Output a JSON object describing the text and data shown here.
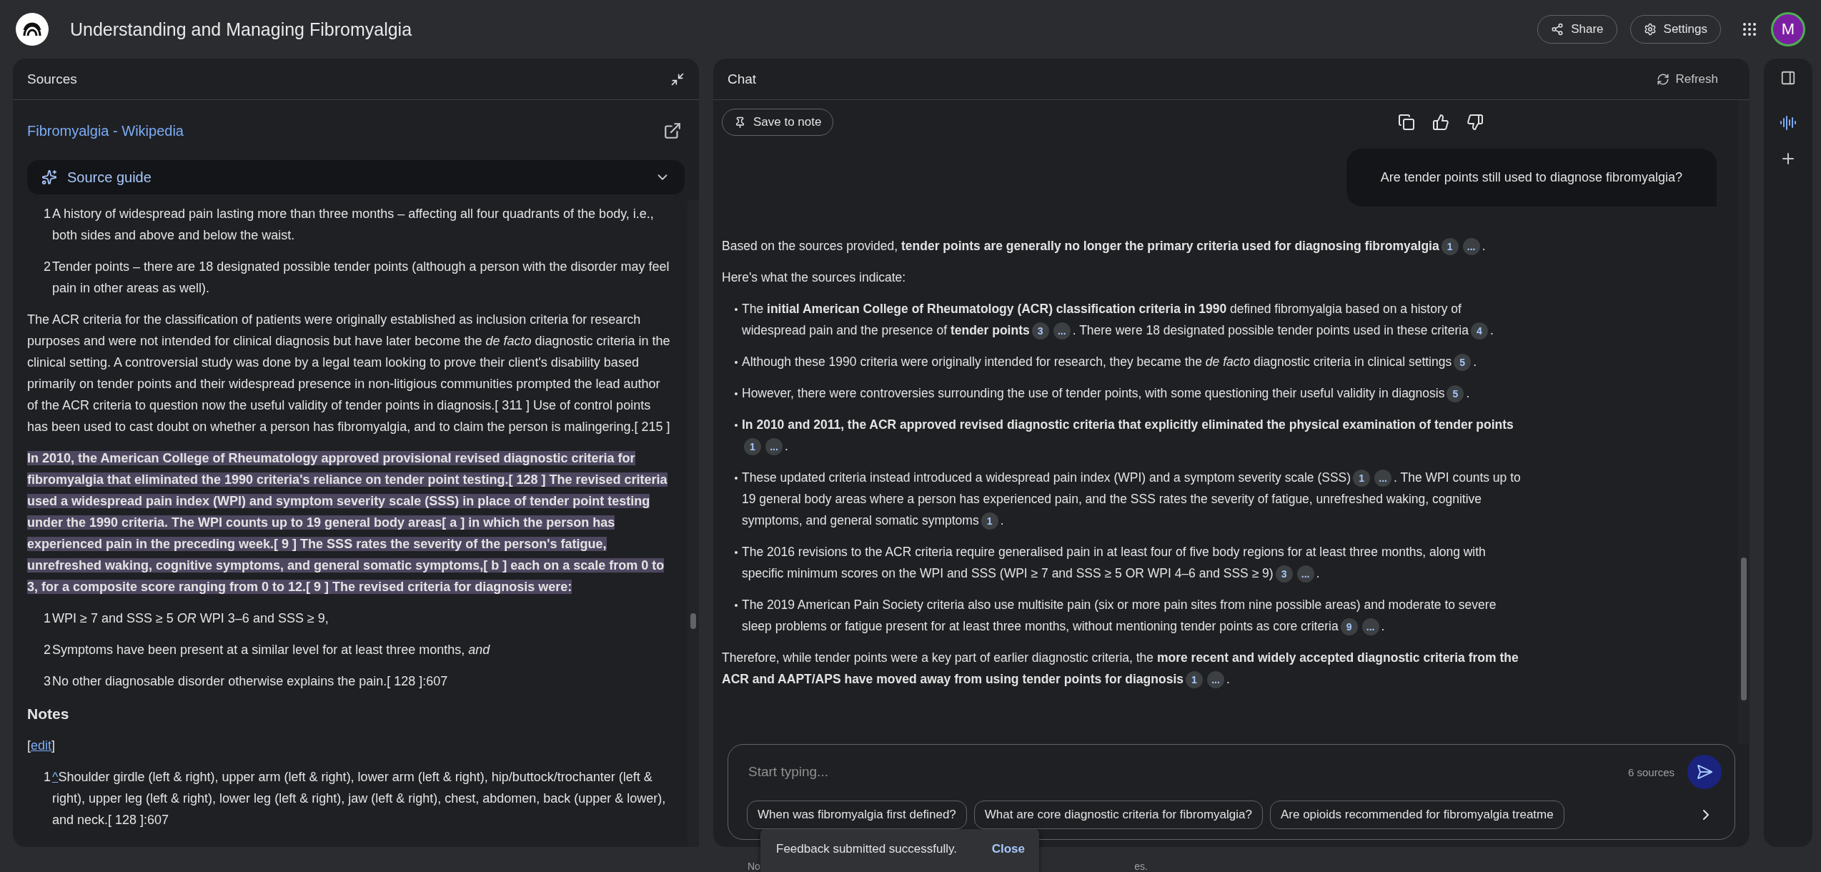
{
  "header": {
    "title": "Understanding and Managing Fibromyalgia",
    "buttons": [
      {
        "kind": "share",
        "label": "Share"
      },
      {
        "kind": "settings",
        "label": "Settings"
      }
    ],
    "avatar": "M"
  },
  "sources": {
    "title": "Sources",
    "source_link": "Fibromyalgia - Wikipedia",
    "source_guide": {
      "label": "Source guide",
      "expanded": false
    },
    "blocks": [
      {
        "kind": "item",
        "number": "1",
        "text": "A history of widespread pain lasting more than three months – affecting all four quadrants of the body, i.e., both sides and above and below the waist."
      },
      {
        "kind": "item",
        "number": "2",
        "text": "Tender points – there are 18 designated possible tender points (although a person with the disorder may feel pain in other areas as well)."
      },
      {
        "kind": "paragraph",
        "highlighted": false,
        "text": "The ACR criteria for the classification of patients were originally established as inclusion criteria for research purposes and were not intended for clinical diagnosis but have later become the *de facto* diagnostic criteria in the clinical setting. A controversial study was done by a legal team looking to prove their client's disability based primarily on tender points and their widespread presence in non-litigious communities prompted the lead author of the ACR criteria to question now the useful validity of tender points in diagnosis.[ 311 ] Use of control points has been used to cast doubt on whether a person has fibromyalgia, and to claim the person is malingering.[ 215 ]"
      },
      {
        "kind": "paragraph",
        "highlighted": true,
        "text": "In 2010, the American College of Rheumatology approved provisional revised diagnostic criteria for fibromyalgia that eliminated the 1990 criteria's reliance on tender point testing.[ 128 ] The revised criteria used a widespread pain index (WPI) and symptom severity scale (SSS) in place of tender point testing under the 1990 criteria. The WPI counts up to 19 general body areas[ a ] in which the person has experienced pain in the preceding week.[ 9 ] The SSS rates the severity of the person's fatigue, unrefreshed waking, cognitive symptoms, and general somatic symptoms,[ b ] each on a scale from 0 to 3, for a composite score ranging from 0 to 12.[ 9 ] The revised criteria for diagnosis were:"
      },
      {
        "kind": "item",
        "number": "1",
        "text": "WPI ≥ 7 and SSS ≥ 5 *OR* WPI 3–6 and SSS ≥ 9,"
      },
      {
        "kind": "item",
        "number": "2",
        "text": "Symptoms have been present at a similar level for at least three months, *and*"
      },
      {
        "kind": "item",
        "number": "3",
        "text": "No other diagnosable disorder otherwise explains the pain.[ 128 ]:607"
      },
      {
        "kind": "heading",
        "text": "Notes"
      },
      {
        "kind": "edit",
        "before": "[",
        "link": "edit",
        "after": "]"
      },
      {
        "kind": "note",
        "number": "1",
        "link": "^",
        "text": "Shoulder girdle (left & right), upper arm (left & right), lower arm (left & right), hip/buttock/trochanter (left & right), upper leg (left & right), lower leg (left & right), jaw (left & right), chest, abdomen, back (upper & lower), and neck.[ 128 ]:607"
      }
    ]
  },
  "chat": {
    "title": "Chat",
    "refresh": "Refresh",
    "save_to_note": "Save to note",
    "user_message": "Are tender points still used to diagnose fibromyalgia?",
    "response": [
      {
        "kind": "paragraph",
        "parts": [
          {
            "kind": "text",
            "text": "Based on the sources provided, **tender points are generally no longer the primary criteria used for diagnosing fibromyalgia**"
          },
          {
            "kind": "cite",
            "label": "1"
          },
          {
            "kind": "cite",
            "label": "..."
          },
          {
            "kind": "text",
            "text": "."
          }
        ]
      },
      {
        "kind": "paragraph",
        "parts": [
          {
            "kind": "text",
            "text": "Here's what the sources indicate:"
          }
        ]
      },
      {
        "kind": "bullet",
        "parts": [
          {
            "kind": "text",
            "text": "The **initial American College of Rheumatology (ACR) classification criteria in 1990** defined fibromyalgia based on a history of widespread pain and the presence of **tender points**"
          },
          {
            "kind": "cite",
            "label": "3"
          },
          {
            "kind": "cite",
            "label": "..."
          },
          {
            "kind": "text",
            "text": ". There were 18 designated possible tender points used in these criteria"
          },
          {
            "kind": "cite",
            "label": "4"
          },
          {
            "kind": "text",
            "text": "."
          }
        ]
      },
      {
        "kind": "bullet",
        "parts": [
          {
            "kind": "text",
            "text": "Although these 1990 criteria were originally intended for research, they became the *de facto* diagnostic criteria in clinical settings"
          },
          {
            "kind": "cite",
            "label": "5"
          },
          {
            "kind": "text",
            "text": "."
          }
        ]
      },
      {
        "kind": "bullet",
        "parts": [
          {
            "kind": "text",
            "text": "However, there were controversies surrounding the use of tender points, with some questioning their useful validity in diagnosis"
          },
          {
            "kind": "cite",
            "label": "5"
          },
          {
            "kind": "text",
            "text": "."
          }
        ]
      },
      {
        "kind": "bullet",
        "parts": [
          {
            "kind": "text",
            "text": "**In 2010 and 2011, the ACR approved revised diagnostic criteria that explicitly eliminated the physical examination of tender points**"
          },
          {
            "kind": "cite",
            "label": "1"
          },
          {
            "kind": "cite",
            "label": "..."
          },
          {
            "kind": "text",
            "text": "."
          }
        ]
      },
      {
        "kind": "bullet",
        "parts": [
          {
            "kind": "text",
            "text": "These updated criteria instead introduced a widespread pain index (WPI) and a symptom severity scale (SSS)"
          },
          {
            "kind": "cite",
            "label": "1"
          },
          {
            "kind": "cite",
            "label": "..."
          },
          {
            "kind": "text",
            "text": ". The WPI counts up to 19 general body areas where a person has experienced pain, and the SSS rates the severity of fatigue, unrefreshed waking, cognitive symptoms, and general somatic symptoms"
          },
          {
            "kind": "cite",
            "label": "1"
          },
          {
            "kind": "text",
            "text": "."
          }
        ]
      },
      {
        "kind": "bullet",
        "parts": [
          {
            "kind": "text",
            "text": "The 2016 revisions to the ACR criteria require generalised pain in at least four of five body regions for at least three months, along with specific minimum scores on the WPI and SSS (WPI ≥ 7 and SSS ≥ 5 OR WPI 4–6 and SSS ≥ 9)"
          },
          {
            "kind": "cite",
            "label": "3"
          },
          {
            "kind": "cite",
            "label": "..."
          },
          {
            "kind": "text",
            "text": "."
          }
        ]
      },
      {
        "kind": "bullet",
        "parts": [
          {
            "kind": "text",
            "text": "The 2019 American Pain Society criteria also use multisite pain (six or more pain sites from nine possible areas) and moderate to severe sleep problems or fatigue present for at least three months, without mentioning tender points as core criteria"
          },
          {
            "kind": "cite",
            "label": "9"
          },
          {
            "kind": "cite",
            "label": "..."
          },
          {
            "kind": "text",
            "text": "."
          }
        ]
      },
      {
        "kind": "paragraph",
        "parts": [
          {
            "kind": "text",
            "text": "Therefore, while tender points were a key part of earlier diagnostic criteria, the **more recent and widely accepted diagnostic criteria from the ACR and AAPT/APS have moved away from using tender points for diagnosis**"
          },
          {
            "kind": "cite",
            "label": "1"
          },
          {
            "kind": "cite",
            "label": "..."
          },
          {
            "kind": "text",
            "text": "."
          }
        ]
      }
    ],
    "input": {
      "placeholder": "Start typing...",
      "source_count": "6 sources"
    },
    "suggestions": [
      "When was fibromyalgia first defined?",
      "What are core diagnostic criteria for fibromyalgia?",
      "Are opioids recommended for fibromyalgia treatme"
    ],
    "footer_start": "No",
    "footer_end": "es."
  },
  "toast": {
    "message": "Feedback submitted successfully.",
    "action": "Close"
  }
}
